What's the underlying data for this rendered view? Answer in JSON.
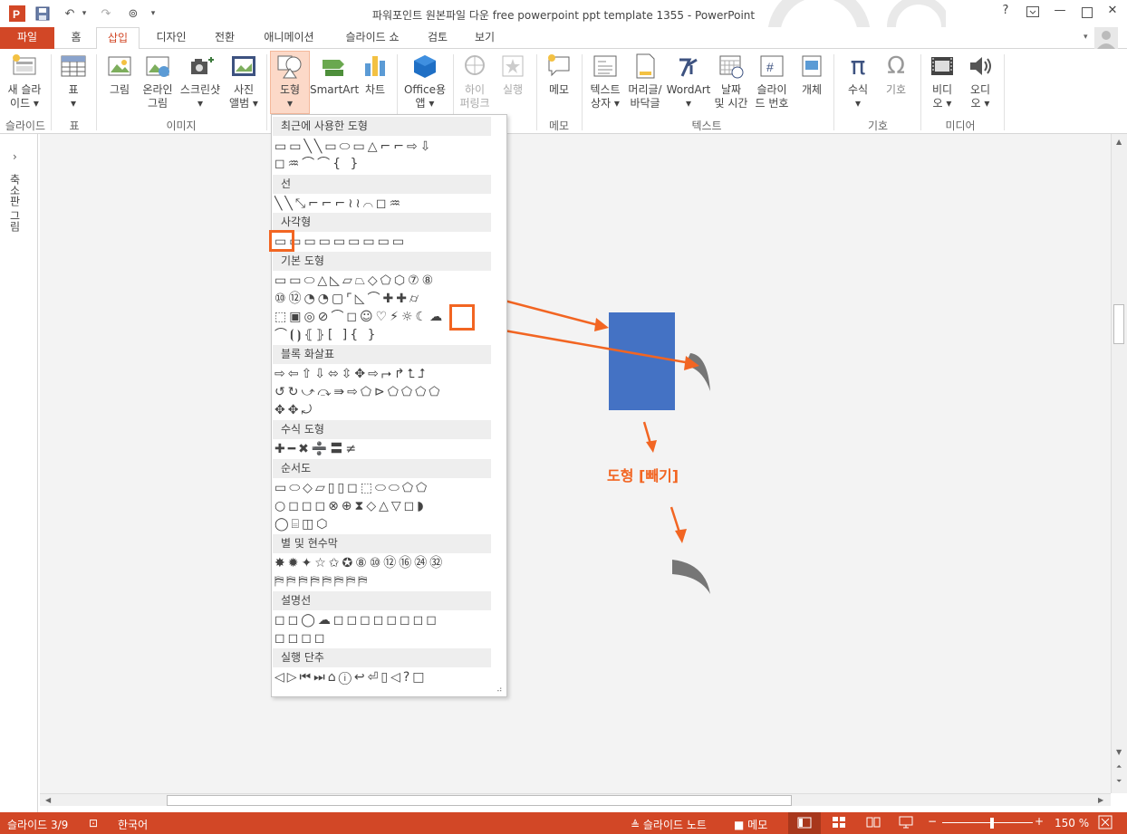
{
  "window": {
    "title": "파워포인트 원본파일 다운 free powerpoint ppt template 1355 - PowerPoint",
    "help": "?",
    "minimize": "—",
    "restore": "❐",
    "close": "✕"
  },
  "qat": {
    "app_icon": "P",
    "save_icon": "floppy",
    "undo_icon": "↶",
    "redo_icon": "↷",
    "present_icon": "⊚",
    "more": "▾"
  },
  "tabs": [
    {
      "label": "파일"
    },
    {
      "label": "홈"
    },
    {
      "label": "삽입"
    },
    {
      "label": "디자인"
    },
    {
      "label": "전환"
    },
    {
      "label": "애니메이션"
    },
    {
      "label": "슬라이드 쇼"
    },
    {
      "label": "검토"
    },
    {
      "label": "보기"
    }
  ],
  "ribbon": {
    "buttons": [
      {
        "label1": "새 슬라",
        "label2": "이드 ▾"
      },
      {
        "label1": "표",
        "label2": "▾"
      },
      {
        "label1": "그림",
        "label2": ""
      },
      {
        "label1": "온라인",
        "label2": "그림"
      },
      {
        "label1": "스크린샷",
        "label2": "▾"
      },
      {
        "label1": "사진",
        "label2": "앨범 ▾"
      },
      {
        "label1": "도형",
        "label2": "▾"
      },
      {
        "label1": "SmartArt",
        "label2": ""
      },
      {
        "label1": "차트",
        "label2": ""
      },
      {
        "label1": "Office용",
        "label2": "앱 ▾"
      },
      {
        "label1": "하이",
        "label2": "퍼링크"
      },
      {
        "label1": "실행",
        "label2": ""
      },
      {
        "label1": "메모",
        "label2": ""
      },
      {
        "label1": "텍스트",
        "label2": "상자 ▾"
      },
      {
        "label1": "머리글/",
        "label2": "바닥글"
      },
      {
        "label1": "WordArt",
        "label2": "▾"
      },
      {
        "label1": "날짜",
        "label2": "및 시간"
      },
      {
        "label1": "슬라이",
        "label2": "드 번호"
      },
      {
        "label1": "개체",
        "label2": ""
      },
      {
        "label1": "수식",
        "label2": "▾"
      },
      {
        "label1": "기호",
        "label2": ""
      },
      {
        "label1": "비디",
        "label2": "오 ▾"
      },
      {
        "label1": "오디",
        "label2": "오 ▾"
      }
    ],
    "groups": [
      "슬라이드",
      "표",
      "이미지",
      "메모",
      "텍스트",
      "기호",
      "미디어"
    ]
  },
  "left_panel": {
    "expand": "›",
    "label": "축소판 그림"
  },
  "shapes_menu": {
    "categories": [
      "최근에 사용한 도형",
      "선",
      "사각형",
      "기본 도형",
      "블록 화살표",
      "수식 도형",
      "순서도",
      "별 및 현수막",
      "설명선",
      "실행 단추"
    ],
    "rows": {
      "recent1": "▭▭╲╲▭⬭▭△⌐⌐⇨⇩",
      "recent2": "◻♒⌒⌒{ }",
      "lines": "╲╲⤡⌐⌐⌐≀≀⌒◻♒",
      "rects": "▭▭▭▭▭▭▭▭▭",
      "basic1": "▭▭⬭△◺▱⏢◇⬠⬡⑦⑧",
      "basic2": "⑩⑫◔◔▢⌜◺⌒✚✚⌭",
      "basic3": "⬚▣◎⊘⌒◻☺♡⚡☼☾☁",
      "basic4": "⌒⦗⦘⦃⦄[ ]{ }",
      "block1": "⇨⇦⇧⇩⬄⇳✥⇨⮣↱⮤⮥",
      "block2": "↺↻⤻⤼⇛⇨⬠⊳⬠⬠⬠⬠",
      "block3": "✥✥⤾",
      "math": "✚━✖➗〓≠",
      "flow1": "▭⬭◇▱▯▯◻⬚⬭⬭⬠⬠",
      "flow2": "○◻◻◻⊗⊕⧗◇△▽◻◗",
      "flow3": "◯⌸◫⬡",
      "stars1": "✸✹✦☆✩✪⑧⑩⑫⑯㉔㉜",
      "stars2": "⛿⛿⛿⛿⛿⛿⛿⛿",
      "callout1": "◻◻◯☁◻◻◻◻◻◻◻◻",
      "callout2": "◻◻◻◻",
      "action": "◁▷⏮⏭⌂ⓘ↩⏎▯◁?□"
    },
    "resize": "⠴"
  },
  "slide": {
    "rect_color": "#4472c4",
    "moon_color": "#767676",
    "callout_text": "도형 [빼기]",
    "arrow_color": "#f26522"
  },
  "statusbar": {
    "slide": "슬라이드 3/9",
    "lang_icon": "⊡",
    "lang": "한국어",
    "notes": "≜ 슬라이드 노트",
    "comments": "■ 메모",
    "zoom_minus": "−",
    "zoom_plus": "+",
    "zoom": "150 %",
    "fit_icon": "⊡",
    "zoom_level": 0.55
  }
}
